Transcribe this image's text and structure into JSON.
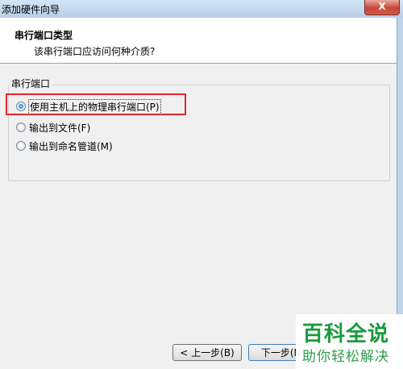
{
  "window": {
    "title": "添加硬件向导",
    "close_label": "X"
  },
  "header": {
    "title": "串行端口类型",
    "subtitle": "该串行端口应访问何种介质?"
  },
  "group": {
    "label": "串行端口",
    "options": [
      {
        "label": "使用主机上的物理串行端口(P)",
        "checked": true
      },
      {
        "label": "输出到文件(F)",
        "checked": false
      },
      {
        "label": "输出到命名管道(M)",
        "checked": false
      }
    ]
  },
  "buttons": {
    "back": "< 上一步(B)",
    "next": "下一步(N)"
  },
  "watermark": {
    "main": "百科全说",
    "sub": "助你轻松解决"
  },
  "colors": {
    "highlight": "#e0262e",
    "watermark_green": "#1a9a3c"
  }
}
